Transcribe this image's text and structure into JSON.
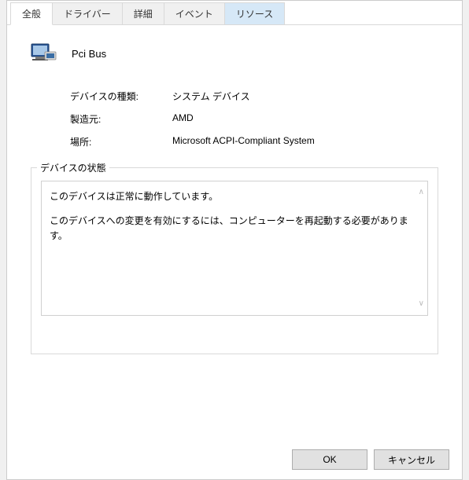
{
  "tabs": [
    {
      "label": "全般",
      "active": true
    },
    {
      "label": "ドライバー",
      "active": false
    },
    {
      "label": "詳細",
      "active": false
    },
    {
      "label": "イベント",
      "active": false
    },
    {
      "label": "リソース",
      "active": false,
      "highlight": true
    }
  ],
  "device": {
    "title": "Pci Bus"
  },
  "info": {
    "type_label": "デバイスの種類:",
    "type_value": "システム デバイス",
    "manufacturer_label": "製造元:",
    "manufacturer_value": "AMD",
    "location_label": "場所:",
    "location_value": "Microsoft ACPI-Compliant System"
  },
  "status": {
    "legend": "デバイスの状態",
    "line1": "このデバイスは正常に動作しています。",
    "line2": "このデバイスへの変更を有効にするには、コンピューターを再起動する必要があります。"
  },
  "buttons": {
    "ok": "OK",
    "cancel": "キャンセル"
  }
}
